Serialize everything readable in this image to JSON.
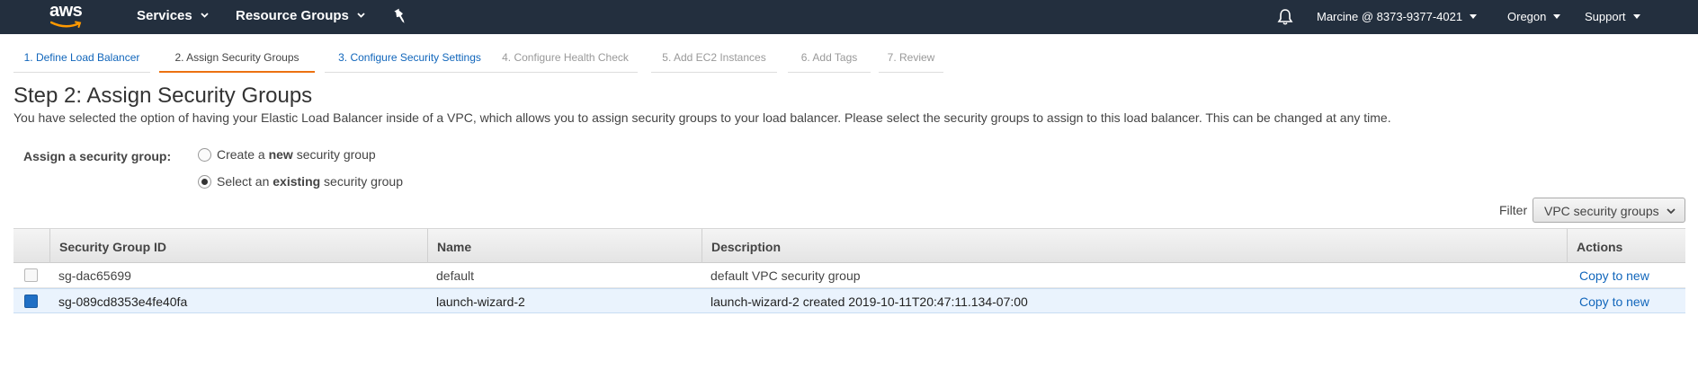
{
  "topnav": {
    "logo_text": "aws",
    "services_label": "Services",
    "resource_groups_label": "Resource Groups",
    "account_label": "Marcine @ 8373-9377-4021",
    "region_label": "Oregon",
    "support_label": "Support"
  },
  "wizard": {
    "steps": [
      {
        "label": "1. Define Load Balancer",
        "state": "done"
      },
      {
        "label": "2. Assign Security Groups",
        "state": "active"
      },
      {
        "label": "3. Configure Security Settings",
        "state": "next"
      },
      {
        "label": "4. Configure Health Check",
        "state": "disabled"
      },
      {
        "label": "5. Add EC2 Instances",
        "state": "disabled"
      },
      {
        "label": "6. Add Tags",
        "state": "disabled"
      },
      {
        "label": "7. Review",
        "state": "disabled"
      }
    ]
  },
  "page": {
    "title": "Step 2: Assign Security Groups",
    "description": "You have selected the option of having your Elastic Load Balancer inside of a VPC, which allows you to assign security groups to your load balancer. Please select the security groups to assign to this load balancer. This can be changed at any time."
  },
  "assign": {
    "label": "Assign a security group:",
    "option_new": {
      "prefix": "Create a ",
      "bold": "new",
      "suffix": " security group",
      "checked": false
    },
    "option_existing": {
      "prefix": "Select an ",
      "bold": "existing",
      "suffix": " security group",
      "checked": true
    }
  },
  "filter": {
    "label": "Filter",
    "selected": "VPC security groups"
  },
  "table": {
    "columns": [
      "Security Group ID",
      "Name",
      "Description",
      "Actions"
    ],
    "rows": [
      {
        "checked": false,
        "id": "sg-dac65699",
        "name": "default",
        "description": "default VPC security group",
        "action": "Copy to new"
      },
      {
        "checked": true,
        "id": "sg-089cd8353e4fe40fa",
        "name": "launch-wizard-2",
        "description": "launch-wizard-2 created 2019-10-11T20:47:11.134-07:00",
        "action": "Copy to new"
      }
    ]
  },
  "colors": {
    "nav_bg": "#232f3e",
    "link": "#1166bb",
    "active_step_underline": "#ec7211",
    "selected_row_bg": "#eaf3fd",
    "checkbox_checked": "#1f6fc5"
  }
}
